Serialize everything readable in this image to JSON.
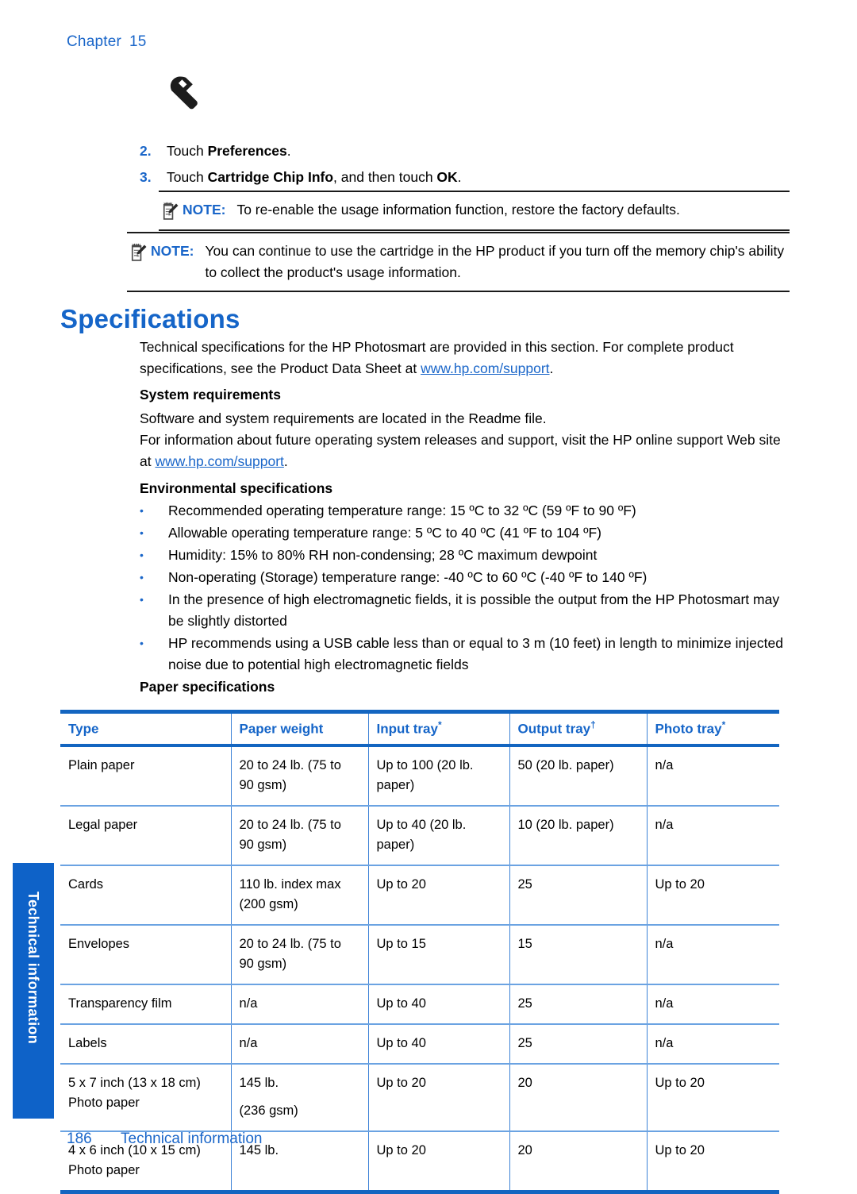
{
  "header": {
    "chapter_label": "Chapter",
    "chapter_number": "15"
  },
  "icons": {
    "wrench": "wrench-icon",
    "note": "note-pad-icon"
  },
  "steps": [
    {
      "number": "2.",
      "prefix": "Touch ",
      "bold": "Preferences",
      "suffix": "."
    },
    {
      "number": "3.",
      "prefix": "Touch ",
      "bold": "Cartridge Chip Info",
      "middle": ", and then touch ",
      "bold2": "OK",
      "suffix": "."
    }
  ],
  "notes": [
    {
      "label": "NOTE:",
      "text": "To re-enable the usage information function, restore the factory defaults."
    },
    {
      "label": "NOTE:",
      "text": "You can continue to use the cartridge in the HP product if you turn off the memory chip's ability to collect the product's usage information."
    }
  ],
  "section": {
    "title": "Specifications",
    "intro_part1": "Technical specifications for the HP Photosmart are provided in this section. For complete product specifications, see the Product Data Sheet at ",
    "intro_link": "www.hp.com/support",
    "intro_part2": "."
  },
  "system_requirements": {
    "heading": "System requirements",
    "paragraph1": "Software and system requirements are located in the Readme file.",
    "paragraph2_part1": "For information about future operating system releases and support, visit the HP online support Web site at ",
    "paragraph2_link": "www.hp.com/support",
    "paragraph2_part2": "."
  },
  "environmental": {
    "heading": "Environmental specifications",
    "bullet_marker": "•",
    "bullets": [
      "Recommended operating temperature range: 15 ºC to 32 ºC (59 ºF to 90 ºF)",
      "Allowable operating temperature range: 5 ºC to 40 ºC (41 ºF to 104 ºF)",
      "Humidity: 15% to 80% RH non-condensing; 28 ºC maximum dewpoint",
      "Non-operating (Storage) temperature range: -40 ºC to 60 ºC (-40 ºF to 140 ºF)",
      "In the presence of high electromagnetic fields, it is possible the output from the HP Photosmart may be slightly distorted",
      "HP recommends using a USB cable less than or equal to 3 m (10 feet) in length to minimize injected noise due to potential high electromagnetic fields"
    ]
  },
  "paper": {
    "heading": "Paper specifications",
    "table": {
      "columns": [
        {
          "label": "Type",
          "mark": ""
        },
        {
          "label": "Paper weight",
          "mark": ""
        },
        {
          "label": "Input tray",
          "mark": "*"
        },
        {
          "label": "Output tray",
          "mark": "†"
        },
        {
          "label": "Photo tray",
          "mark": "*"
        }
      ],
      "rows": [
        {
          "type": "Plain paper",
          "type_line2": "",
          "weight": "20 to 24 lb. (75 to",
          "weight_line2": "90 gsm)",
          "input": "Up to 100 (20 lb.",
          "input_line2": "paper)",
          "output": "50 (20 lb. paper)",
          "photo": "n/a"
        },
        {
          "type": "Legal paper",
          "type_line2": "",
          "weight": "20 to 24 lb. (75 to",
          "weight_line2": "90 gsm)",
          "input": "Up to 40 (20 lb.",
          "input_line2": "paper)",
          "output": "10 (20 lb. paper)",
          "photo": "n/a"
        },
        {
          "type": "Cards",
          "type_line2": "",
          "weight": "110 lb. index max",
          "weight_line2": "(200 gsm)",
          "input": "Up to 20",
          "input_line2": "",
          "output": "25",
          "photo": "Up to 20"
        },
        {
          "type": "Envelopes",
          "type_line2": "",
          "weight": "20 to 24 lb. (75 to",
          "weight_line2": "90 gsm)",
          "input": "Up to 15",
          "input_line2": "",
          "output": "15",
          "photo": "n/a"
        },
        {
          "type": "Transparency film",
          "type_line2": "",
          "weight": "n/a",
          "weight_line2": "",
          "input": "Up to 40",
          "input_line2": "",
          "output": "25",
          "photo": "n/a"
        },
        {
          "type": "Labels",
          "type_line2": "",
          "weight": "n/a",
          "weight_line2": "",
          "input": "Up to 40",
          "input_line2": "",
          "output": "25",
          "photo": "n/a"
        },
        {
          "type": "5 x 7 inch (13 x 18 cm)",
          "type_line2": "Photo paper",
          "weight": "145 lb.",
          "weight_line2": "(236 gsm)",
          "input": "Up to 20",
          "input_line2": "",
          "output": "20",
          "photo": "Up to 20"
        },
        {
          "type": "4 x 6 inch (10 x 15 cm)",
          "type_line2": "Photo paper",
          "weight": "145 lb.",
          "weight_line2": "",
          "input": "Up to 20",
          "input_line2": "",
          "output": "20",
          "photo": "Up to 20"
        }
      ]
    }
  },
  "side_tab": {
    "label": "Technical information"
  },
  "footer": {
    "page_number": "186",
    "section_label": "Technical information"
  },
  "colors": {
    "accent_blue": "#1a66c9",
    "heading_blue": "#1565c8",
    "table_rule": "#1365c0",
    "tab_blue": "#0e62c8"
  }
}
